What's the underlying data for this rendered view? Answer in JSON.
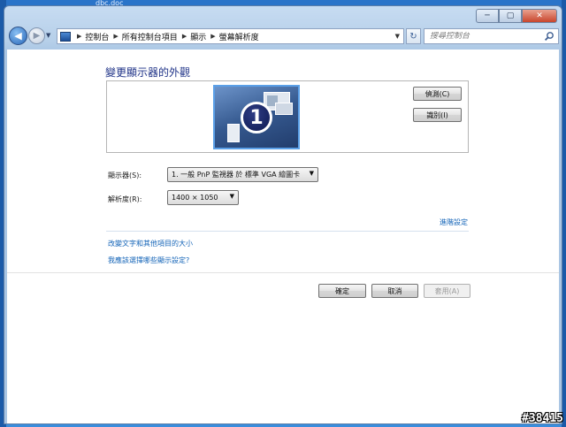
{
  "desktop": {
    "file_label": "dbc.doc",
    "watermark": "#38415"
  },
  "window": {
    "caption_buttons": {
      "minimize": "─",
      "maximize": "▢",
      "close": "✕"
    },
    "address_bar": {
      "breadcrumbs": [
        "控制台",
        "所有控制台項目",
        "顯示",
        "螢幕解析度"
      ],
      "refresh_icon": "refresh-icon"
    },
    "search": {
      "placeholder": "搜尋控制台"
    }
  },
  "main": {
    "title": "變更顯示器的外觀",
    "monitor_number": "1",
    "detect_button": "偵測(C)",
    "identify_button": "識別(I)",
    "display_label": "顯示器(S):",
    "display_value": "1. 一般 PnP 監視器 於 標準 VGA 繪圖卡",
    "resolution_label": "解析度(R):",
    "resolution_value": "1400 × 1050",
    "advanced_link": "進階設定",
    "links": [
      "改變文字和其他項目的大小",
      "我應該選擇哪些顯示設定?"
    ]
  },
  "footer": {
    "ok": "確定",
    "cancel": "取消",
    "apply": "套用(A)"
  },
  "colors": {
    "title_blue": "#1e3287",
    "link_blue": "#1565b8",
    "desktop_blue": "#2f7fd0"
  }
}
